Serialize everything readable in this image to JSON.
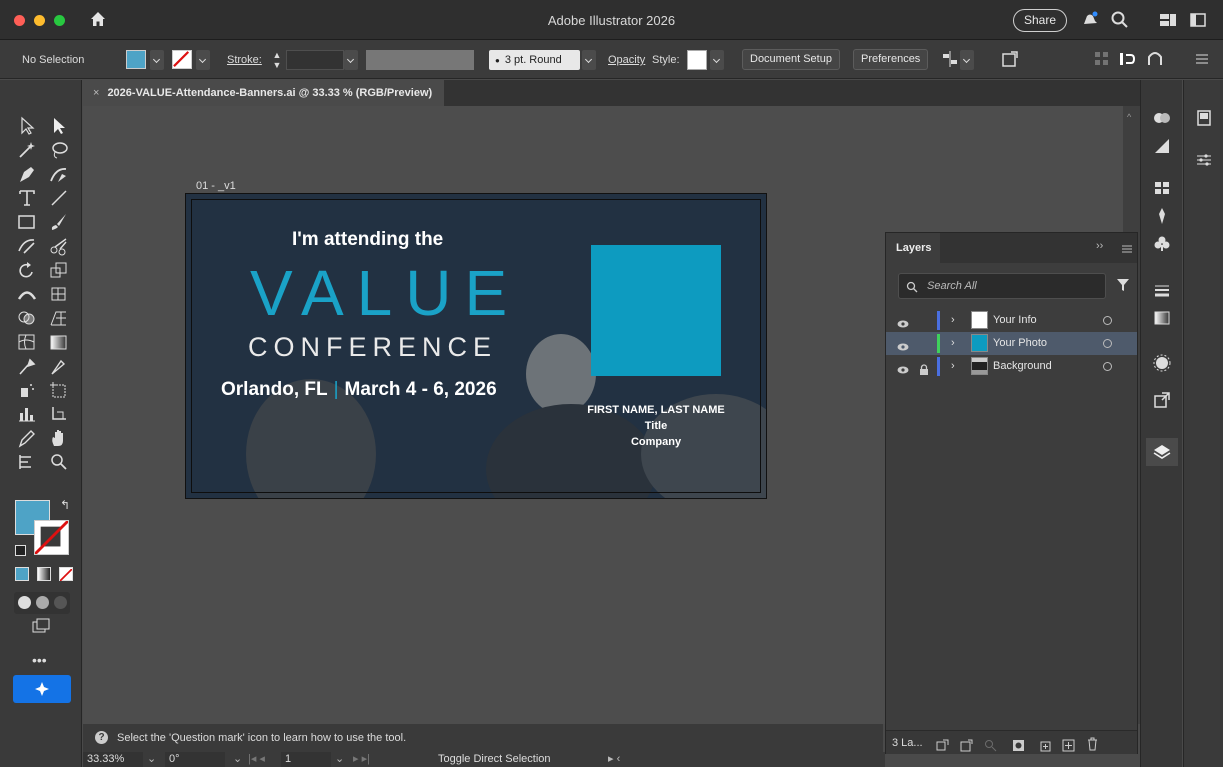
{
  "app": {
    "title": "Adobe Illustrator 2026",
    "share_label": "Share"
  },
  "controlbar": {
    "selection": "No Selection",
    "stroke_label": "Stroke:",
    "brush": "3 pt. Round",
    "opacity_label": "Opacity",
    "style_label": "Style:",
    "document_setup": "Document Setup",
    "preferences": "Preferences"
  },
  "document": {
    "tab_title": "2026-VALUE-Attendance-Banners.ai @ 33.33 % (RGB/Preview)"
  },
  "artboard": {
    "label": "01 - _v1",
    "headline": "I'm attending the",
    "value": "VALUE",
    "conference": "CONFERENCE",
    "city": "Orlando, FL",
    "separator": "|",
    "dates": "March 4 - 6, 2026",
    "name": "FIRST NAME, LAST NAME",
    "title": "Title",
    "company": "Company"
  },
  "layers_panel": {
    "title": "Layers",
    "search_placeholder": "Search All",
    "layers": [
      {
        "name": "Your Info",
        "color": "#4a6fe0",
        "selected": false,
        "locked": false
      },
      {
        "name": "Your Photo",
        "color": "#3fd15c",
        "selected": true,
        "locked": false
      },
      {
        "name": "Background",
        "color": "#4a6fe0",
        "selected": false,
        "locked": true
      }
    ],
    "footer_count": "3 La..."
  },
  "hint": {
    "text": "Select the 'Question mark' icon to learn how to use the tool."
  },
  "status": {
    "zoom": "33.33%",
    "rotation": "0°",
    "artboard_num": "1",
    "tool_name": "Toggle Direct Selection"
  },
  "colors": {
    "accent": "#1aa2c7",
    "fill_swatch": "#4ea3c6",
    "photo_placeholder": "#0d9bc0",
    "selected_row": "#4e5a6b"
  }
}
